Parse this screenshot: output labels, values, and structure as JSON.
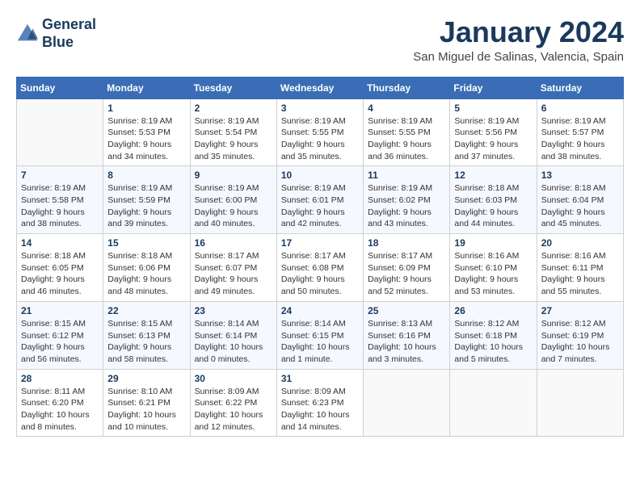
{
  "header": {
    "logo_line1": "General",
    "logo_line2": "Blue",
    "month_title": "January 2024",
    "location": "San Miguel de Salinas, Valencia, Spain"
  },
  "calendar": {
    "columns": [
      "Sunday",
      "Monday",
      "Tuesday",
      "Wednesday",
      "Thursday",
      "Friday",
      "Saturday"
    ],
    "weeks": [
      [
        {
          "day": "",
          "info": ""
        },
        {
          "day": "1",
          "info": "Sunrise: 8:19 AM\nSunset: 5:53 PM\nDaylight: 9 hours\nand 34 minutes."
        },
        {
          "day": "2",
          "info": "Sunrise: 8:19 AM\nSunset: 5:54 PM\nDaylight: 9 hours\nand 35 minutes."
        },
        {
          "day": "3",
          "info": "Sunrise: 8:19 AM\nSunset: 5:55 PM\nDaylight: 9 hours\nand 35 minutes."
        },
        {
          "day": "4",
          "info": "Sunrise: 8:19 AM\nSunset: 5:55 PM\nDaylight: 9 hours\nand 36 minutes."
        },
        {
          "day": "5",
          "info": "Sunrise: 8:19 AM\nSunset: 5:56 PM\nDaylight: 9 hours\nand 37 minutes."
        },
        {
          "day": "6",
          "info": "Sunrise: 8:19 AM\nSunset: 5:57 PM\nDaylight: 9 hours\nand 38 minutes."
        }
      ],
      [
        {
          "day": "7",
          "info": "Sunrise: 8:19 AM\nSunset: 5:58 PM\nDaylight: 9 hours\nand 38 minutes."
        },
        {
          "day": "8",
          "info": "Sunrise: 8:19 AM\nSunset: 5:59 PM\nDaylight: 9 hours\nand 39 minutes."
        },
        {
          "day": "9",
          "info": "Sunrise: 8:19 AM\nSunset: 6:00 PM\nDaylight: 9 hours\nand 40 minutes."
        },
        {
          "day": "10",
          "info": "Sunrise: 8:19 AM\nSunset: 6:01 PM\nDaylight: 9 hours\nand 42 minutes."
        },
        {
          "day": "11",
          "info": "Sunrise: 8:19 AM\nSunset: 6:02 PM\nDaylight: 9 hours\nand 43 minutes."
        },
        {
          "day": "12",
          "info": "Sunrise: 8:18 AM\nSunset: 6:03 PM\nDaylight: 9 hours\nand 44 minutes."
        },
        {
          "day": "13",
          "info": "Sunrise: 8:18 AM\nSunset: 6:04 PM\nDaylight: 9 hours\nand 45 minutes."
        }
      ],
      [
        {
          "day": "14",
          "info": "Sunrise: 8:18 AM\nSunset: 6:05 PM\nDaylight: 9 hours\nand 46 minutes."
        },
        {
          "day": "15",
          "info": "Sunrise: 8:18 AM\nSunset: 6:06 PM\nDaylight: 9 hours\nand 48 minutes."
        },
        {
          "day": "16",
          "info": "Sunrise: 8:17 AM\nSunset: 6:07 PM\nDaylight: 9 hours\nand 49 minutes."
        },
        {
          "day": "17",
          "info": "Sunrise: 8:17 AM\nSunset: 6:08 PM\nDaylight: 9 hours\nand 50 minutes."
        },
        {
          "day": "18",
          "info": "Sunrise: 8:17 AM\nSunset: 6:09 PM\nDaylight: 9 hours\nand 52 minutes."
        },
        {
          "day": "19",
          "info": "Sunrise: 8:16 AM\nSunset: 6:10 PM\nDaylight: 9 hours\nand 53 minutes."
        },
        {
          "day": "20",
          "info": "Sunrise: 8:16 AM\nSunset: 6:11 PM\nDaylight: 9 hours\nand 55 minutes."
        }
      ],
      [
        {
          "day": "21",
          "info": "Sunrise: 8:15 AM\nSunset: 6:12 PM\nDaylight: 9 hours\nand 56 minutes."
        },
        {
          "day": "22",
          "info": "Sunrise: 8:15 AM\nSunset: 6:13 PM\nDaylight: 9 hours\nand 58 minutes."
        },
        {
          "day": "23",
          "info": "Sunrise: 8:14 AM\nSunset: 6:14 PM\nDaylight: 10 hours\nand 0 minutes."
        },
        {
          "day": "24",
          "info": "Sunrise: 8:14 AM\nSunset: 6:15 PM\nDaylight: 10 hours\nand 1 minute."
        },
        {
          "day": "25",
          "info": "Sunrise: 8:13 AM\nSunset: 6:16 PM\nDaylight: 10 hours\nand 3 minutes."
        },
        {
          "day": "26",
          "info": "Sunrise: 8:12 AM\nSunset: 6:18 PM\nDaylight: 10 hours\nand 5 minutes."
        },
        {
          "day": "27",
          "info": "Sunrise: 8:12 AM\nSunset: 6:19 PM\nDaylight: 10 hours\nand 7 minutes."
        }
      ],
      [
        {
          "day": "28",
          "info": "Sunrise: 8:11 AM\nSunset: 6:20 PM\nDaylight: 10 hours\nand 8 minutes."
        },
        {
          "day": "29",
          "info": "Sunrise: 8:10 AM\nSunset: 6:21 PM\nDaylight: 10 hours\nand 10 minutes."
        },
        {
          "day": "30",
          "info": "Sunrise: 8:09 AM\nSunset: 6:22 PM\nDaylight: 10 hours\nand 12 minutes."
        },
        {
          "day": "31",
          "info": "Sunrise: 8:09 AM\nSunset: 6:23 PM\nDaylight: 10 hours\nand 14 minutes."
        },
        {
          "day": "",
          "info": ""
        },
        {
          "day": "",
          "info": ""
        },
        {
          "day": "",
          "info": ""
        }
      ]
    ]
  }
}
